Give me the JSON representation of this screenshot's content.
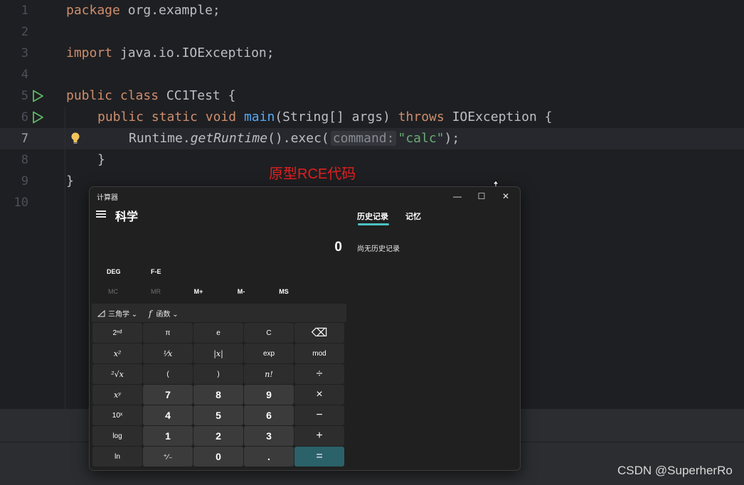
{
  "editor": {
    "line_numbers": [
      "1",
      "2",
      "3",
      "4",
      "5",
      "6",
      "7",
      "8",
      "9",
      "10"
    ],
    "line1": {
      "kw": "package",
      "rest": " org.example;"
    },
    "line3": {
      "kw": "import",
      "rest": " java.io.IOException;"
    },
    "line5": {
      "kw1": "public",
      "kw2": "class",
      "name": " CC1Test {"
    },
    "line6": {
      "kw1": "public",
      "kw2": "static",
      "kw3": "void",
      "method": "main",
      "params": "(String[] args) ",
      "throws": "throws",
      "rest": " IOException {"
    },
    "line7": {
      "obj": "Runtime.",
      "method": "getRuntime",
      "call": "().exec(",
      "hint": "command:",
      "str": "\"calc\"",
      "end": ");"
    },
    "line8": "}",
    "line9": "}"
  },
  "annotation": "原型RCE代码",
  "calculator": {
    "window_title": "计算器",
    "minimize": "—",
    "maximize": "☐",
    "close": "✕",
    "mode": "科学",
    "display": "0",
    "history_tab": "历史记录",
    "memory_tab": "记忆",
    "history_empty": "尚无历史记录",
    "angle": "DEG",
    "fe": "F-E",
    "memory_buttons": [
      "MC",
      "MR",
      "M+",
      "M-",
      "MS"
    ],
    "trig_label": "三角学",
    "func_label": "函数",
    "keys": [
      [
        "2ⁿᵈ",
        "π",
        "e",
        "C",
        "⌫"
      ],
      [
        "x²",
        "¹⁄x",
        "|x|",
        "exp",
        "mod"
      ],
      [
        "²√x",
        "(",
        ")",
        "n!",
        "÷"
      ],
      [
        "xʸ",
        "7",
        "8",
        "9",
        "×"
      ],
      [
        "10ˣ",
        "4",
        "5",
        "6",
        "−"
      ],
      [
        "log",
        "1",
        "2",
        "3",
        "+"
      ],
      [
        "ln",
        "⁺⁄₋",
        "0",
        ".",
        "="
      ]
    ]
  },
  "watermark": "CSDN @SuperherRo"
}
